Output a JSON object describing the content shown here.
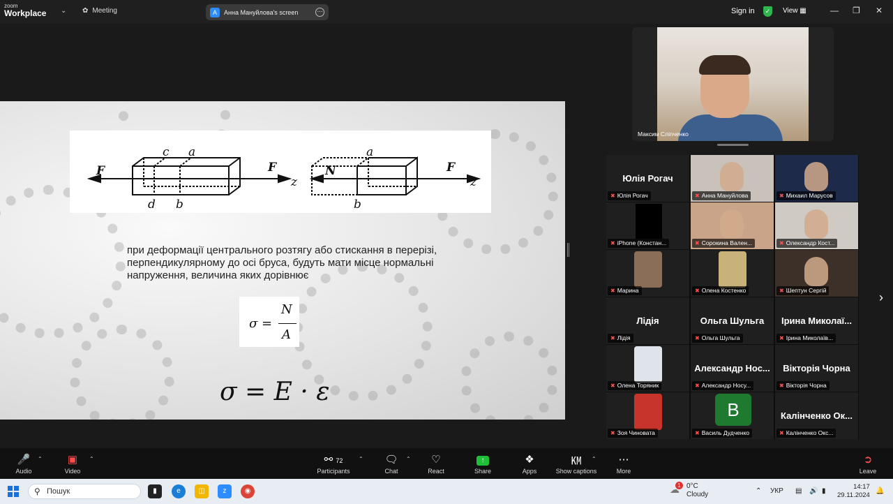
{
  "titlebar": {
    "logo_small": "zoom",
    "logo_big": "Workplace",
    "meeting_label": "Meeting",
    "screen_share_initial": "A",
    "screen_share_label": "Анна Мануйлова's screen",
    "signin": "Sign in",
    "view": "View"
  },
  "slide": {
    "diagram": {
      "left_labels": {
        "F_left": "F",
        "c": "c",
        "a": "a",
        "d": "d",
        "b": "b",
        "F_right": "F",
        "z": "z"
      },
      "right_labels": {
        "N": "N",
        "a": "a",
        "b": "b",
        "F": "F",
        "z": "z"
      }
    },
    "text": "при деформації центрального розтягу або стискання в перерізі, перпендикулярному до осі бруса, будуть мати місце нормальні напруження, величина яких дорівнює",
    "formula1": {
      "lhs": "σ =",
      "num": "N",
      "den": "A"
    },
    "formula2": "σ = E · ε"
  },
  "speaker": {
    "name": "Максим Сліпченко"
  },
  "gallery": [
    {
      "big": "Юлія Рогач",
      "chip": "Юлія Рогач",
      "type": "name"
    },
    {
      "big": "",
      "chip": "Анна Мануйлова",
      "type": "video",
      "color": "#c9c2bb"
    },
    {
      "big": "",
      "chip": "Михаил Марусов",
      "type": "video",
      "color": "#1d2a4a"
    },
    {
      "big": "",
      "chip": "iPhone (Констан...",
      "type": "black"
    },
    {
      "big": "",
      "chip": "Сорокина Вален...",
      "type": "video",
      "color": "#caa489"
    },
    {
      "big": "",
      "chip": "Олександр Кост...",
      "type": "video",
      "color": "#cfcac3"
    },
    {
      "big": "",
      "chip": "Марина",
      "type": "avatar",
      "color": "#8a6e57"
    },
    {
      "big": "",
      "chip": "Олена Костенко",
      "type": "avatar",
      "color": "#c9b27a"
    },
    {
      "big": "",
      "chip": "Шептун Сергій",
      "type": "video",
      "color": "#3d3028"
    },
    {
      "big": "Лідія",
      "chip": "Лідія",
      "type": "name"
    },
    {
      "big": "Ольга Шульга",
      "chip": "Ольга Шульга",
      "type": "name"
    },
    {
      "big": "Ірина  Миколаї...",
      "chip": "Ірина Миколаїв...",
      "type": "name"
    },
    {
      "big": "",
      "chip": "Олена Торяник",
      "type": "avatar",
      "color": "#dfe4ea"
    },
    {
      "big": "Александр  Нос...",
      "chip": "Александр Носу...",
      "type": "name"
    },
    {
      "big": "Вікторія Чорна",
      "chip": "Вікторія Чорна",
      "type": "name"
    },
    {
      "big": "",
      "chip": "Зоя Чиновата",
      "type": "avatar",
      "color": "#c7342b"
    },
    {
      "big": "B",
      "chip": "Василь Дудченко",
      "type": "letter",
      "color": "#1e7a2e"
    },
    {
      "big": "Калінченко  Ок...",
      "chip": "Калінченко Окс...",
      "type": "name"
    }
  ],
  "toolbar": {
    "audio": "Audio",
    "video": "Video",
    "participants": "Participants",
    "participants_count": "72",
    "chat": "Chat",
    "react": "React",
    "share": "Share",
    "apps": "Apps",
    "captions": "Show captions",
    "more": "More",
    "leave": "Leave"
  },
  "taskbar": {
    "search": "Пошук",
    "weather_badge": "1",
    "temp": "0°C",
    "weather": "Cloudy",
    "lang": "УКР",
    "time": "14:17",
    "date": "29.11.2024"
  }
}
